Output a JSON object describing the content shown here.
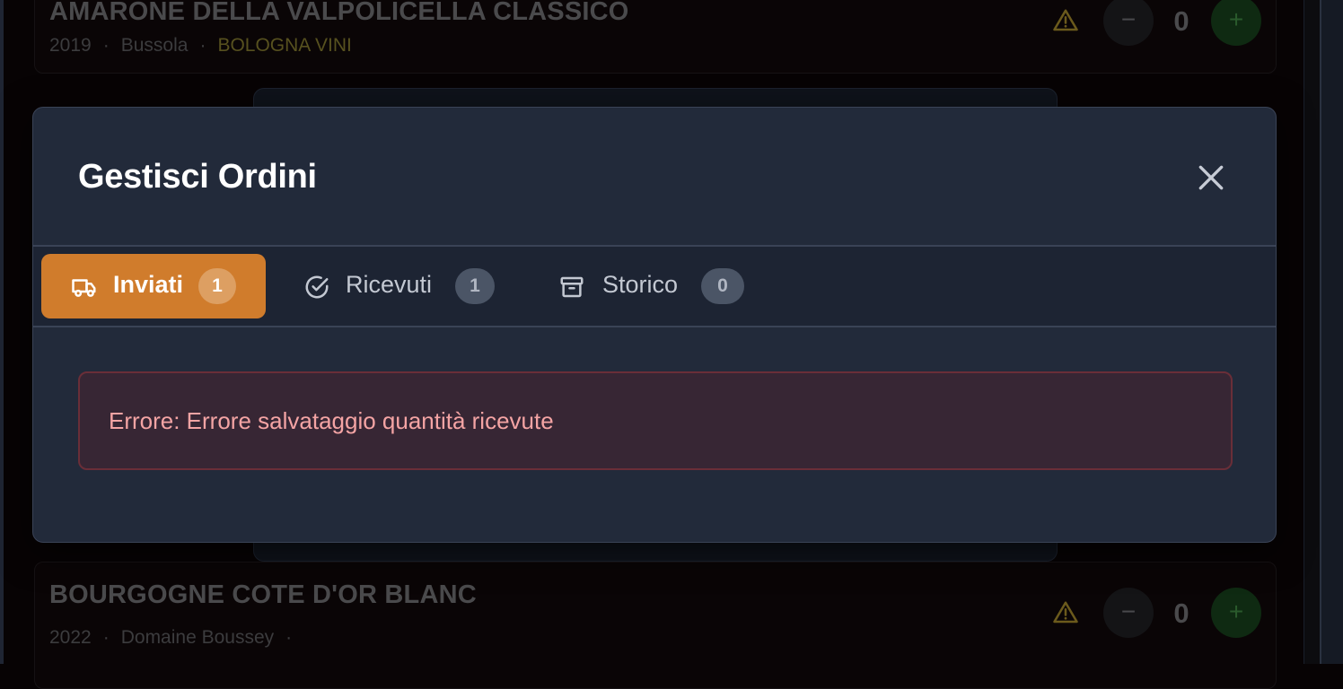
{
  "background_items": [
    {
      "name": "AMARONE DELLA VALPOLICELLA CLASSICO",
      "year": "2019",
      "producer": "Bussola",
      "distributor": "BOLOGNA VINI",
      "quantity": "0"
    },
    {
      "name": "BOURGOGNE COTE D'OR BLANC",
      "year": "2022",
      "producer": "Domaine Boussey",
      "distributor": "",
      "quantity": "0"
    }
  ],
  "controls": {
    "minus_label": "−",
    "plus_label": "+",
    "separator": "·"
  },
  "modal": {
    "title": "Gestisci Ordini",
    "close_icon": "close-icon",
    "tabs": [
      {
        "label": "Inviati",
        "count": "1",
        "icon": "truck-icon",
        "active": true
      },
      {
        "label": "Ricevuti",
        "count": "1",
        "icon": "check-circle-icon",
        "active": false
      },
      {
        "label": "Storico",
        "count": "0",
        "icon": "archive-icon",
        "active": false
      }
    ],
    "error_message": "Errore: Errore salvataggio quantità ricevute"
  },
  "colors": {
    "modal_bg": "#222a3a",
    "accent_orange": "#d07c2c",
    "error_text": "#f4a4a4",
    "error_border": "#6a2e38"
  }
}
